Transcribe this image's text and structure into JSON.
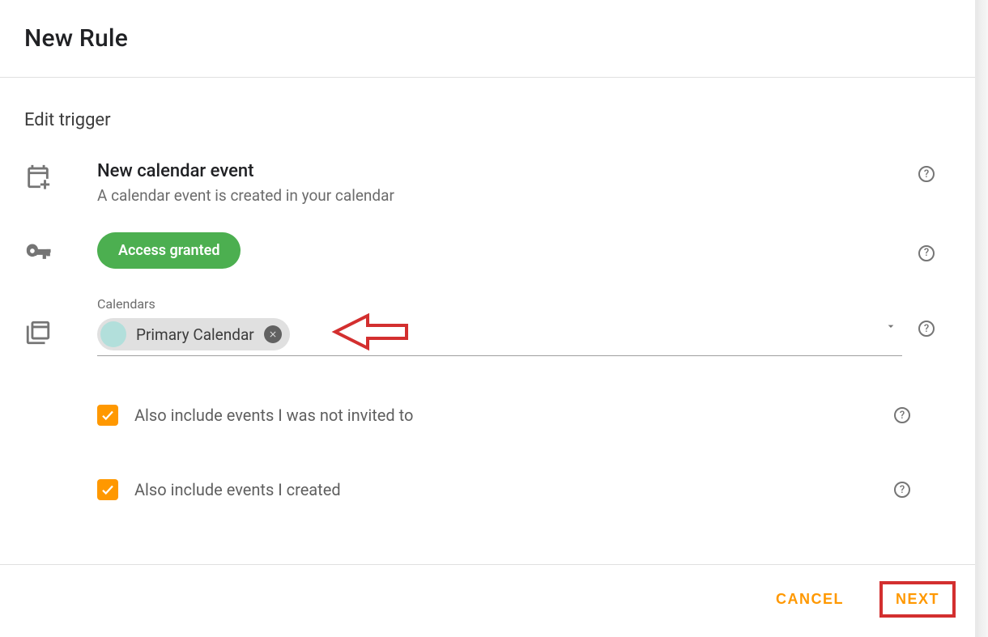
{
  "header": {
    "title": "New Rule"
  },
  "section": {
    "title": "Edit trigger"
  },
  "trigger": {
    "title": "New calendar event",
    "description": "A calendar event is created in your calendar"
  },
  "access": {
    "label": "Access granted"
  },
  "calendars": {
    "label": "Calendars",
    "chip": {
      "text": "Primary Calendar"
    }
  },
  "options": {
    "not_invited": {
      "label": "Also include events I was not invited to",
      "checked": true
    },
    "created": {
      "label": "Also include events I created",
      "checked": true
    }
  },
  "footer": {
    "cancel": "CANCEL",
    "next": "NEXT"
  },
  "colors": {
    "accent": "#ff9800",
    "success": "#4CAF50"
  }
}
